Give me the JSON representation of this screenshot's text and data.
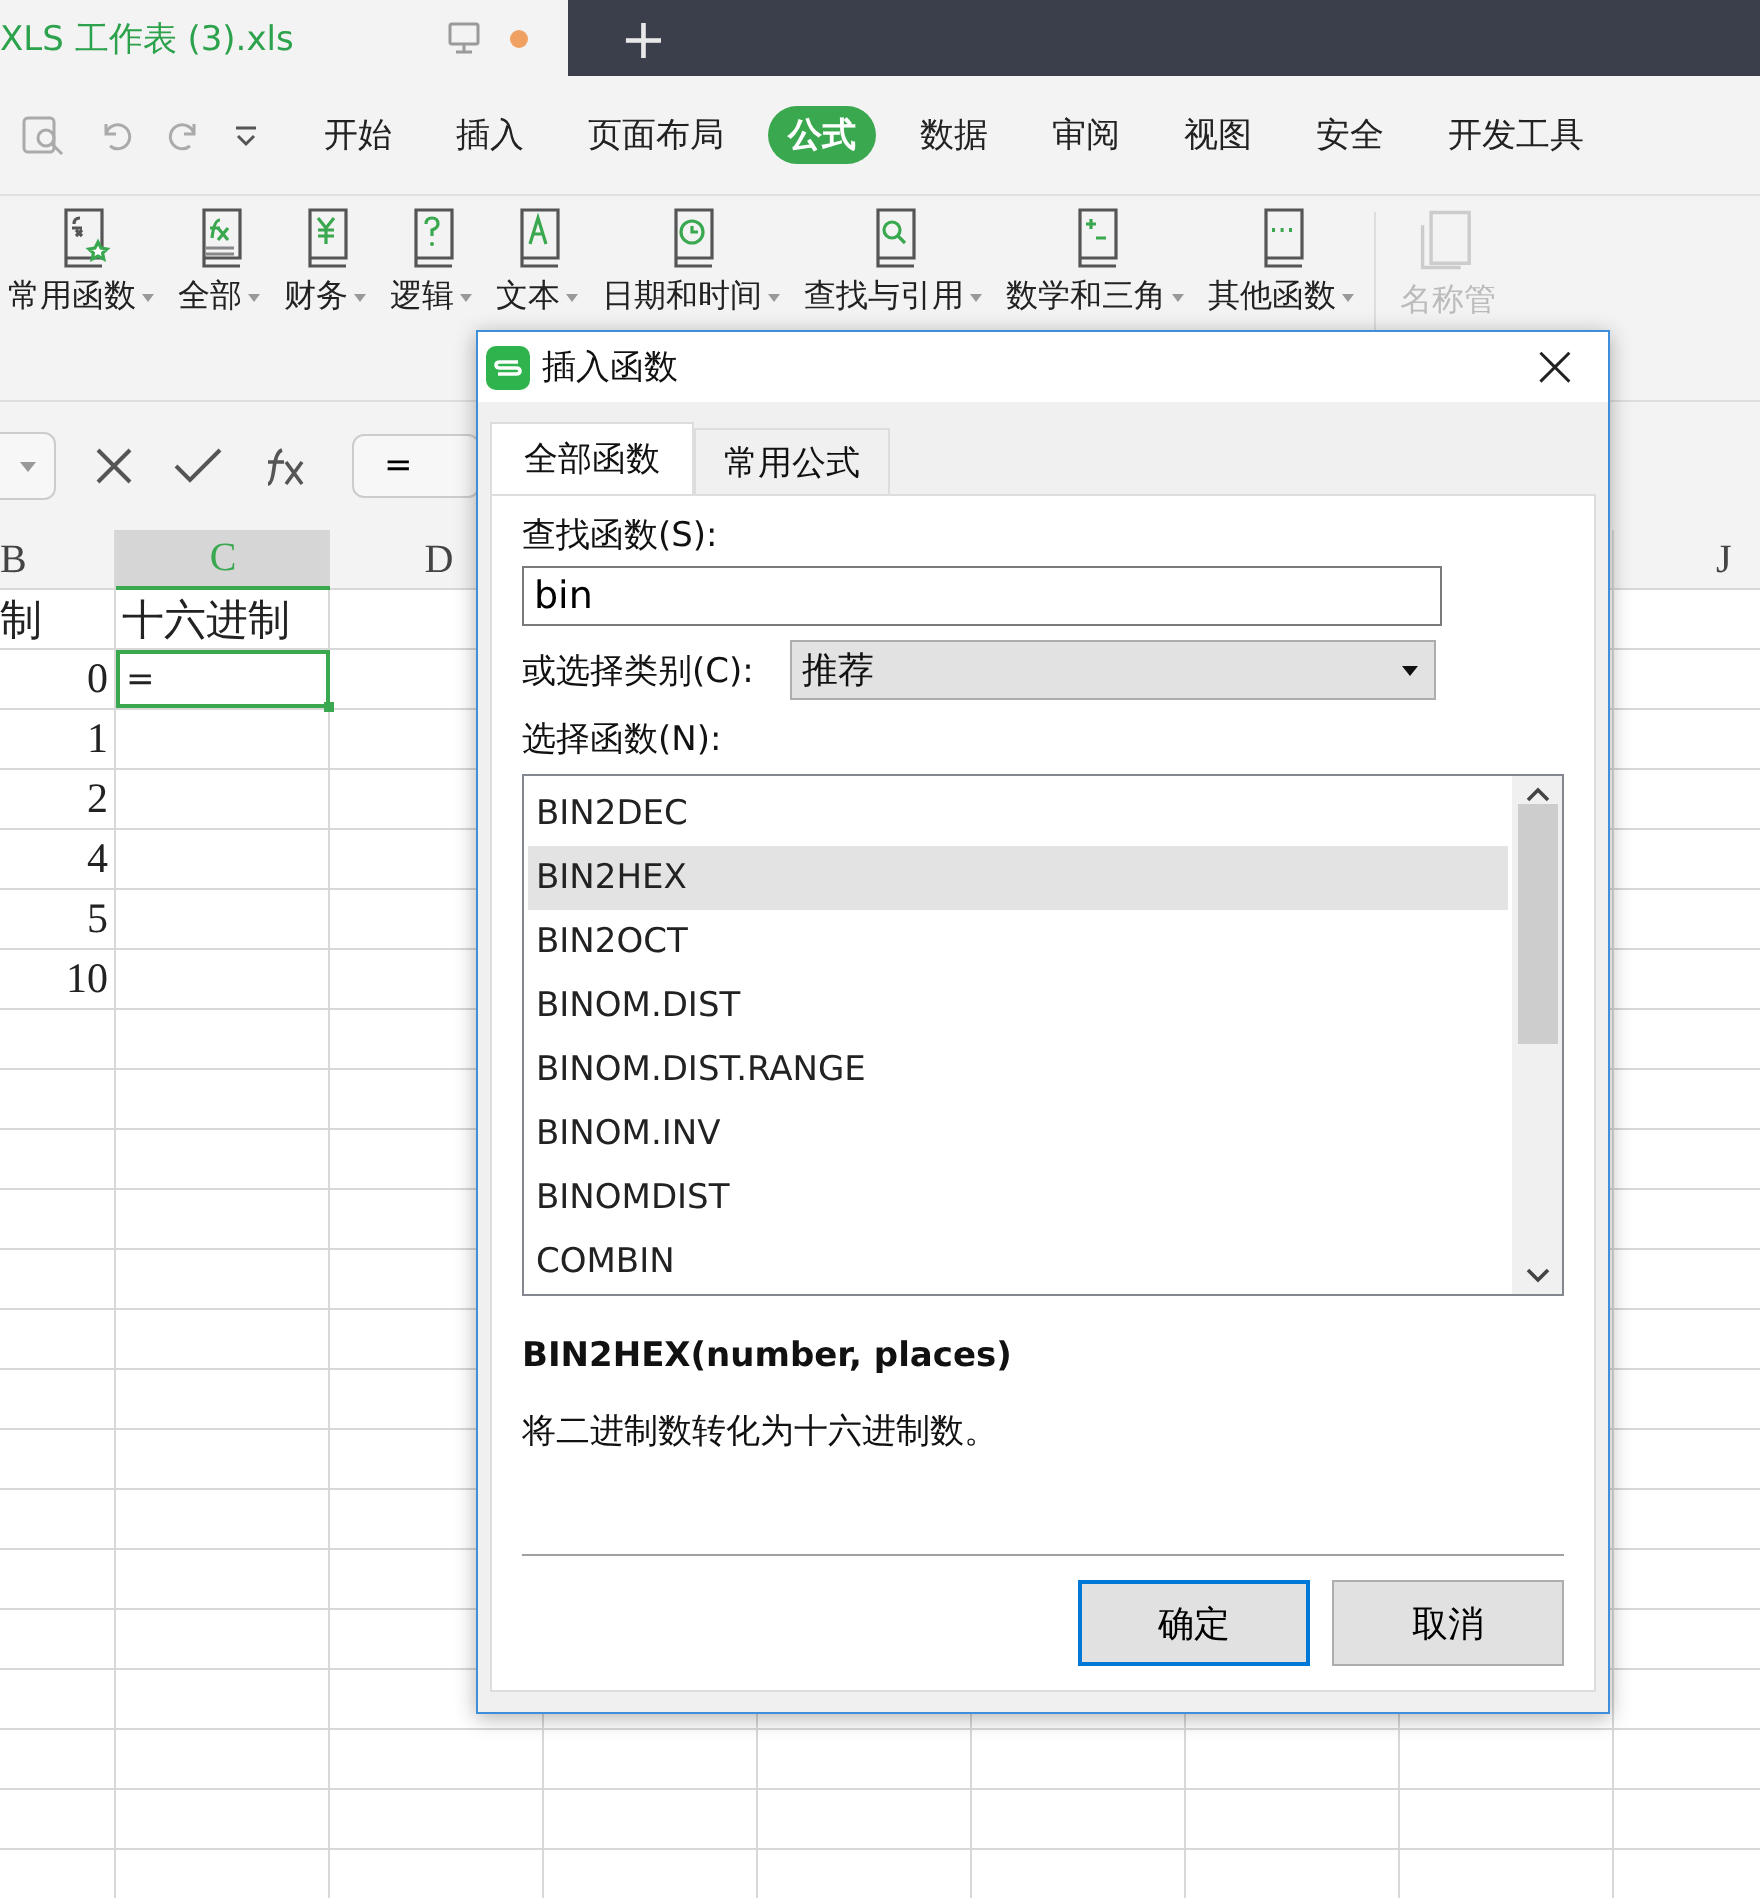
{
  "doc_tab": {
    "title": "XLS 工作表 (3).xls",
    "new_tab": "+"
  },
  "menu": {
    "items": [
      {
        "label": "开始",
        "selected": false
      },
      {
        "label": "插入",
        "selected": false
      },
      {
        "label": "页面布局",
        "selected": false
      },
      {
        "label": "公式",
        "selected": true
      },
      {
        "label": "数据",
        "selected": false
      },
      {
        "label": "审阅",
        "selected": false
      },
      {
        "label": "视图",
        "selected": false
      },
      {
        "label": "安全",
        "selected": false
      },
      {
        "label": "开发工具",
        "selected": false
      }
    ]
  },
  "ribbon": {
    "buttons": [
      {
        "label": "常用函数",
        "kind": "favorite"
      },
      {
        "label": "全部",
        "kind": "all"
      },
      {
        "label": "财务",
        "kind": "finance"
      },
      {
        "label": "逻辑",
        "kind": "logic"
      },
      {
        "label": "文本",
        "kind": "text"
      },
      {
        "label": "日期和时间",
        "kind": "date"
      },
      {
        "label": "查找与引用",
        "kind": "lookup"
      },
      {
        "label": "数学和三角",
        "kind": "math"
      },
      {
        "label": "其他函数",
        "kind": "other"
      }
    ],
    "disabled_button": "名称管"
  },
  "formula_bar": {
    "value": "="
  },
  "sheet": {
    "columns": [
      {
        "label": "B",
        "selected": false
      },
      {
        "label": "C",
        "selected": true
      },
      {
        "label": "D",
        "selected": false
      },
      {
        "label": "J",
        "selected": false
      }
    ],
    "rows": [
      {
        "b": "制",
        "c": "十六进制",
        "selected": false
      },
      {
        "b": "0",
        "c": "=",
        "selected": true
      },
      {
        "b": "1",
        "selected": false
      },
      {
        "b": "2",
        "selected": false
      },
      {
        "b": "4",
        "selected": false
      },
      {
        "b": "5",
        "selected": false
      },
      {
        "b": "10",
        "selected": false
      }
    ]
  },
  "dialog": {
    "title": "插入函数",
    "close": "×",
    "tabs": [
      {
        "label": "全部函数",
        "selected": true
      },
      {
        "label": "常用公式",
        "selected": false
      }
    ],
    "search_label": "查找函数(S):",
    "search_value": "bin",
    "category_label": "或选择类别(C):",
    "category_value": "推荐",
    "list_label": "选择函数(N):",
    "functions": [
      {
        "name": "BIN2DEC",
        "selected": false
      },
      {
        "name": "BIN2HEX",
        "selected": true
      },
      {
        "name": "BIN2OCT",
        "selected": false
      },
      {
        "name": "BINOM.DIST",
        "selected": false
      },
      {
        "name": "BINOM.DIST.RANGE",
        "selected": false
      },
      {
        "name": "BINOM.INV",
        "selected": false
      },
      {
        "name": "BINOMDIST",
        "selected": false
      },
      {
        "name": "COMBIN",
        "selected": false
      }
    ],
    "signature": "BIN2HEX(number, places)",
    "description": "将二进制数转化为十六进制数。",
    "buttons": [
      {
        "label": "确定",
        "kind": "primary"
      },
      {
        "label": "取消",
        "kind": "secondary"
      }
    ]
  }
}
